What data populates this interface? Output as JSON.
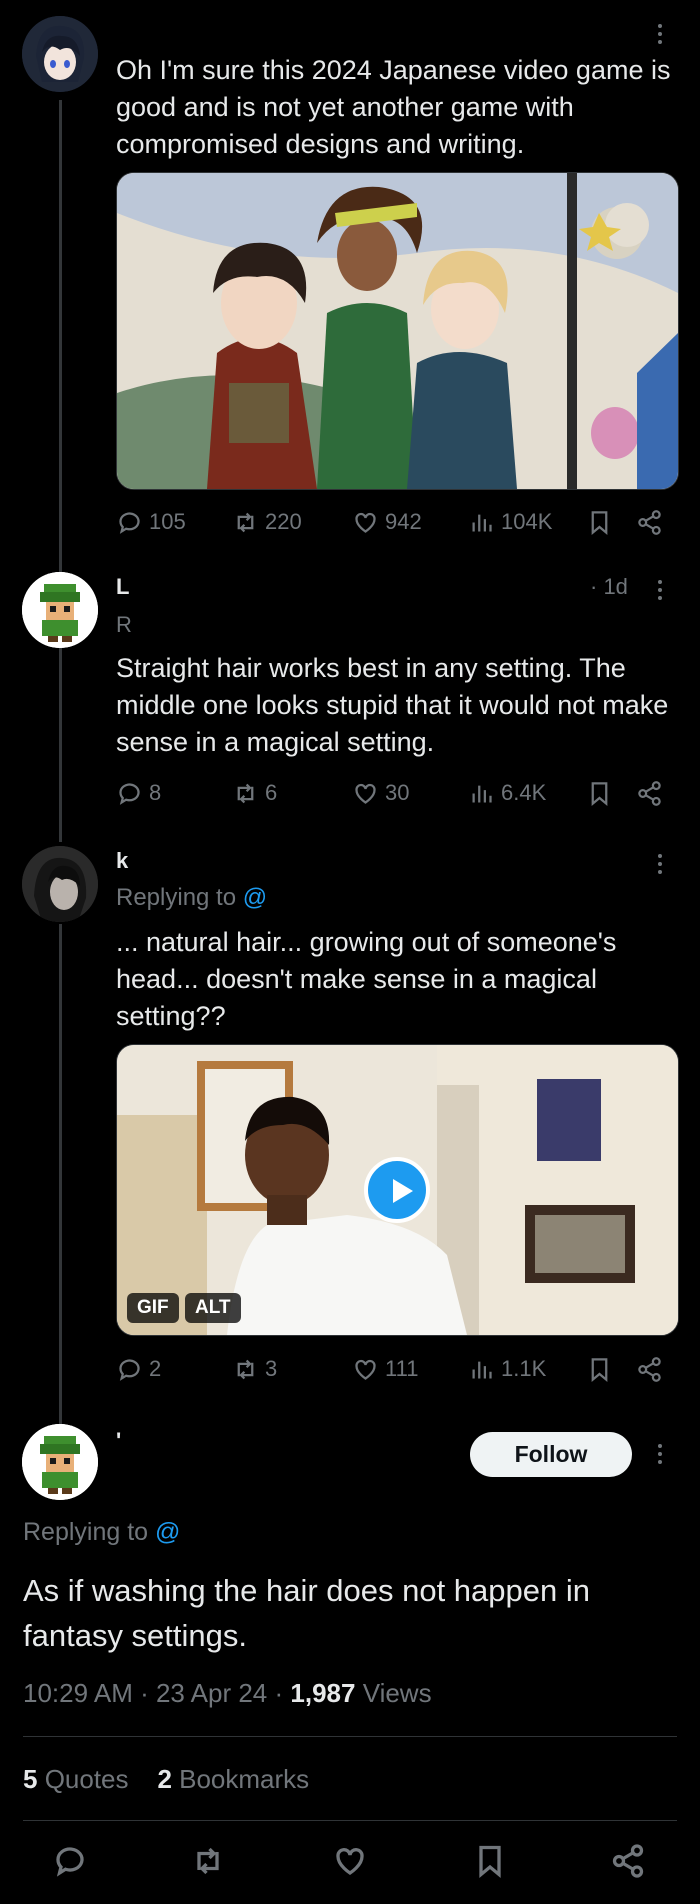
{
  "posts": [
    {
      "name": "",
      "handle": "",
      "text": "Oh I'm sure this 2024 Japanese video game is good and is not yet another game with compromised designs and writing.",
      "media_type": "image",
      "stats": {
        "replies": "105",
        "reposts": "220",
        "likes": "942",
        "views": "104K"
      }
    },
    {
      "name": "L",
      "handle": "R",
      "time": "· 1d",
      "text": "Straight hair works best in any setting. The middle one looks stupid that it would not make sense in a magical setting.",
      "stats": {
        "replies": "8",
        "reposts": "6",
        "likes": "30",
        "views": "6.4K"
      }
    },
    {
      "name": "k",
      "replying_label": "Replying to",
      "replying_to": "@",
      "text": "... natural hair... growing out of someone's head... doesn't make sense in a magical setting??",
      "media_type": "gif",
      "badges": {
        "gif": "GIF",
        "alt": "ALT"
      },
      "stats": {
        "replies": "2",
        "reposts": "3",
        "likes": "111",
        "views": "1.1K"
      }
    }
  ],
  "main": {
    "name": "'",
    "follow_label": "Follow",
    "replying_label": "Replying to",
    "replying_to": "@",
    "text": "As if washing the hair does not happen in fantasy settings.",
    "time": "10:29 AM · 23 Apr 24 · ",
    "views_count": "1,987",
    "views_label": " Views",
    "quotes_count": "5",
    "quotes_label": " Quotes",
    "bookmarks_count": "2",
    "bookmarks_label": " Bookmarks"
  },
  "icons": {
    "reply": "speech-bubble-icon",
    "repost": "repost-arrows-icon",
    "like": "heart-icon",
    "views": "bar-chart-icon",
    "bookmark": "bookmark-icon",
    "share": "share-nodes-icon"
  },
  "colors": {
    "accent": "#1d9bf0",
    "background": "#000000",
    "muted": "#71767b"
  }
}
